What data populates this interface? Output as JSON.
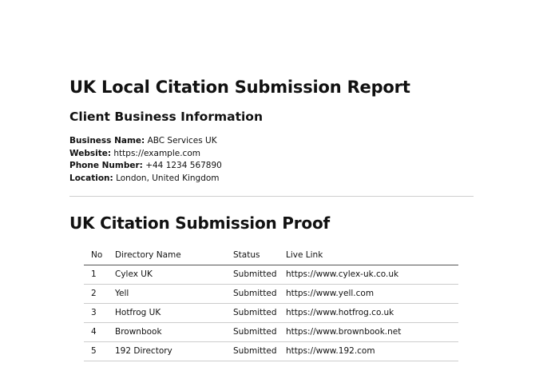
{
  "report": {
    "title": "UK Local Citation Submission Report"
  },
  "client": {
    "heading": "Client Business Information",
    "fields": [
      {
        "label": "Business Name:",
        "value": "ABC Services UK"
      },
      {
        "label": "Website:",
        "value": "https://example.com"
      },
      {
        "label": "Phone Number:",
        "value": "+44 1234 567890"
      },
      {
        "label": "Location:",
        "value": "London, United Kingdom"
      }
    ]
  },
  "proof": {
    "heading": "UK Citation Submission Proof",
    "columns": [
      "No",
      "Directory Name",
      "Status",
      "Live Link"
    ],
    "rows": [
      {
        "no": "1",
        "name": "Cylex UK",
        "status": "Submitted",
        "link": "https://www.cylex-uk.co.uk"
      },
      {
        "no": "2",
        "name": "Yell",
        "status": "Submitted",
        "link": "https://www.yell.com"
      },
      {
        "no": "3",
        "name": "Hotfrog UK",
        "status": "Submitted",
        "link": "https://www.hotfrog.co.uk"
      },
      {
        "no": "4",
        "name": "Brownbook",
        "status": "Submitted",
        "link": "https://www.brownbook.net"
      },
      {
        "no": "5",
        "name": "192 Directory",
        "status": "Submitted",
        "link": "https://www.192.com"
      }
    ]
  }
}
